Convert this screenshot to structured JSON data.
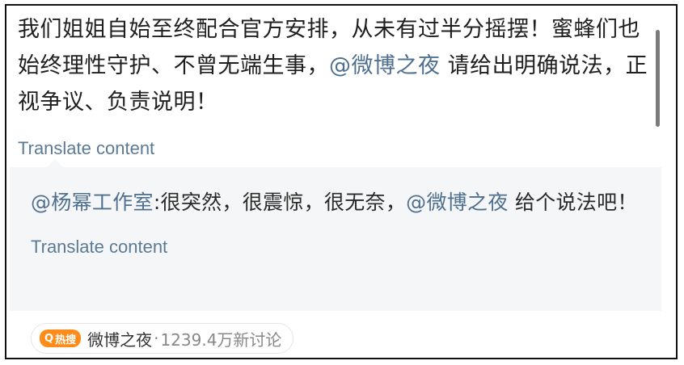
{
  "post": {
    "text_before": "我们姐姐自始至终配合官方安排，从未有过半分摇摆！蜜蜂们也始终理性守护、不曾无端生事，",
    "mention": "@微博之夜",
    "text_after": " 请给出明确说法，正视争议、负责说明！",
    "translate_label": "Translate content"
  },
  "quote": {
    "mention_author": "@杨幂工作室",
    "text_middle": ":很突然，很震惊，很无奈，",
    "mention": "@微博之夜",
    "text_after": " 给个说法吧！",
    "translate_label": "Translate content"
  },
  "topic": {
    "badge_icon": "search-icon",
    "badge_label": "热搜",
    "name": "微博之夜",
    "separator": "·",
    "count": "1239.4万新讨论"
  },
  "colors": {
    "mention": "#4f6f8f",
    "translate": "#5b7a96",
    "quote_bg": "#f5f6f7",
    "badge": "#ff8b1a"
  }
}
